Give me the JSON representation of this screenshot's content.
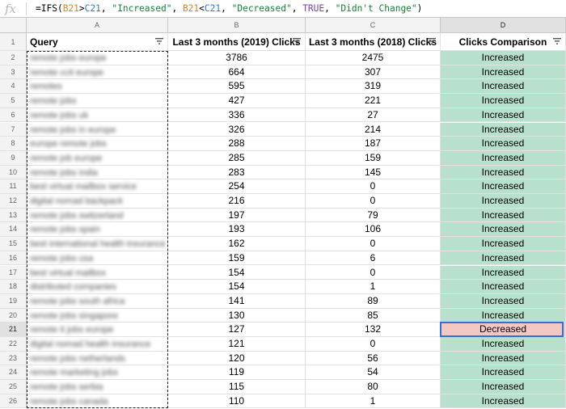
{
  "formula_bar": {
    "icon": "fx-icon",
    "formula_tokens": [
      {
        "t": "=IFS(",
        "c": ""
      },
      {
        "t": "B21",
        "c": "ref1"
      },
      {
        "t": ">",
        "c": ""
      },
      {
        "t": "C21",
        "c": "ref2"
      },
      {
        "t": ", ",
        "c": ""
      },
      {
        "t": "\"Increased\"",
        "c": "str"
      },
      {
        "t": ", ",
        "c": ""
      },
      {
        "t": "B21",
        "c": "ref1"
      },
      {
        "t": "<",
        "c": ""
      },
      {
        "t": "C21",
        "c": "ref2"
      },
      {
        "t": ", ",
        "c": ""
      },
      {
        "t": "\"Decreased\"",
        "c": "str"
      },
      {
        "t": ", ",
        "c": ""
      },
      {
        "t": "TRUE",
        "c": "bool"
      },
      {
        "t": ", ",
        "c": ""
      },
      {
        "t": "\"Didn't Change\"",
        "c": "str"
      },
      {
        "t": ")",
        "c": ""
      }
    ]
  },
  "column_letters": [
    "A",
    "B",
    "C",
    "D"
  ],
  "selected_column": "D",
  "headers": [
    "Query",
    "Last 3 months (2019) Clicks",
    "Last 3 months (2018) Clicks",
    "Clicks Comparison"
  ],
  "header_row_number": "1",
  "selected_row": "21",
  "rows": [
    {
      "n": "2",
      "q": "remote jobs europe",
      "b": "3786",
      "c": "2475",
      "d": "Increased"
    },
    {
      "n": "3",
      "q": "remote ccit europe",
      "b": "664",
      "c": "307",
      "d": "Increased"
    },
    {
      "n": "4",
      "q": "remotes",
      "b": "595",
      "c": "319",
      "d": "Increased"
    },
    {
      "n": "5",
      "q": "remote jobs",
      "b": "427",
      "c": "221",
      "d": "Increased"
    },
    {
      "n": "6",
      "q": "remote jobs uk",
      "b": "336",
      "c": "27",
      "d": "Increased"
    },
    {
      "n": "7",
      "q": "remote jobs in europe",
      "b": "326",
      "c": "214",
      "d": "Increased"
    },
    {
      "n": "8",
      "q": "europe remote jobs",
      "b": "288",
      "c": "187",
      "d": "Increased"
    },
    {
      "n": "9",
      "q": "remote job europe",
      "b": "285",
      "c": "159",
      "d": "Increased"
    },
    {
      "n": "10",
      "q": "remote jobs india",
      "b": "283",
      "c": "145",
      "d": "Increased"
    },
    {
      "n": "11",
      "q": "best virtual mailbox service",
      "b": "254",
      "c": "0",
      "d": "Increased"
    },
    {
      "n": "12",
      "q": "digital nomad backpack",
      "b": "216",
      "c": "0",
      "d": "Increased"
    },
    {
      "n": "13",
      "q": "remote jobs switzerland",
      "b": "197",
      "c": "79",
      "d": "Increased"
    },
    {
      "n": "14",
      "q": "remote jobs spain",
      "b": "193",
      "c": "106",
      "d": "Increased"
    },
    {
      "n": "15",
      "q": "best international health insurance",
      "b": "162",
      "c": "0",
      "d": "Increased"
    },
    {
      "n": "16",
      "q": "remote jobs usa",
      "b": "159",
      "c": "6",
      "d": "Increased"
    },
    {
      "n": "17",
      "q": "best virtual mailbox",
      "b": "154",
      "c": "0",
      "d": "Increased"
    },
    {
      "n": "18",
      "q": "distributed companies",
      "b": "154",
      "c": "1",
      "d": "Increased"
    },
    {
      "n": "19",
      "q": "remote jobs south africa",
      "b": "141",
      "c": "89",
      "d": "Increased"
    },
    {
      "n": "20",
      "q": "remote jobs singapore",
      "b": "130",
      "c": "85",
      "d": "Increased"
    },
    {
      "n": "21",
      "q": "remote it jobs europe",
      "b": "127",
      "c": "132",
      "d": "Decreased"
    },
    {
      "n": "22",
      "q": "digital nomad health insurance",
      "b": "121",
      "c": "0",
      "d": "Increased"
    },
    {
      "n": "23",
      "q": "remote jobs netherlands",
      "b": "120",
      "c": "56",
      "d": "Increased"
    },
    {
      "n": "24",
      "q": "remote marketing jobs",
      "b": "119",
      "c": "54",
      "d": "Increased"
    },
    {
      "n": "25",
      "q": "remote jobs serbia",
      "b": "115",
      "c": "80",
      "d": "Increased"
    },
    {
      "n": "26",
      "q": "remote jobs canada",
      "b": "110",
      "c": "1",
      "d": "Increased"
    }
  ],
  "colors": {
    "increased_fill": "#b7e1cd",
    "decreased_fill": "#f4c7c3",
    "selection": "#2a73d8"
  }
}
